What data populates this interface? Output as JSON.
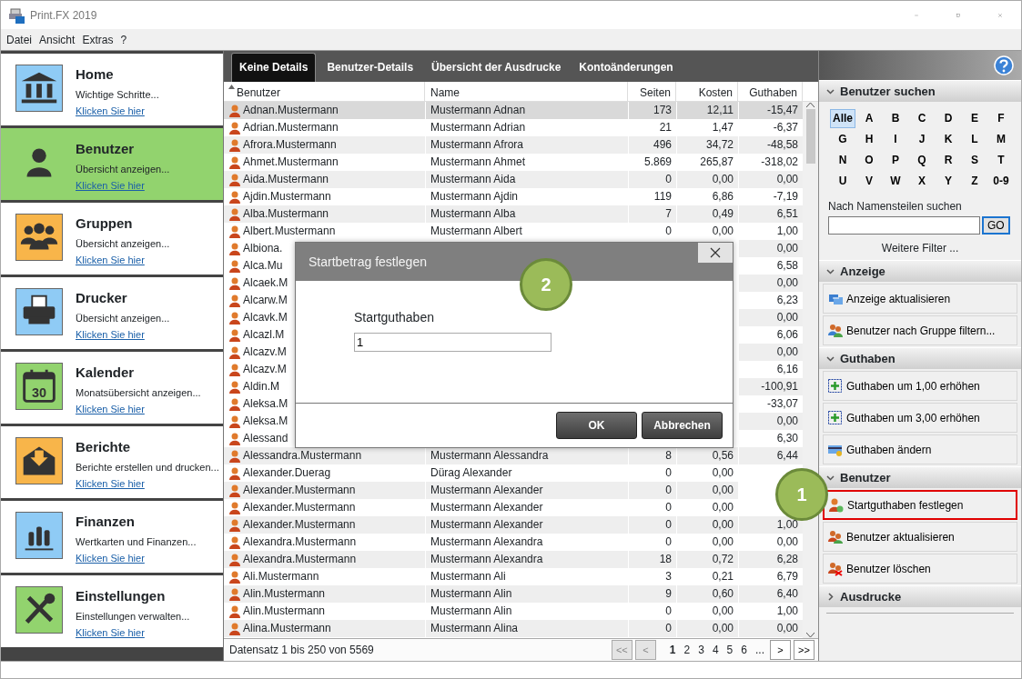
{
  "window": {
    "title": "Print.FX 2019"
  },
  "menu": [
    "Datei",
    "Ansicht",
    "Extras",
    "?"
  ],
  "nav": [
    {
      "title": "Home",
      "subtitle": "Wichtige Schritte...",
      "link": "Klicken Sie hier",
      "selected": false,
      "color": "#8fcbf5"
    },
    {
      "title": "Benutzer",
      "subtitle": "Übersicht anzeigen...",
      "link": "Klicken Sie hier",
      "selected": true,
      "color": "#92d36e"
    },
    {
      "title": "Gruppen",
      "subtitle": "Übersicht anzeigen...",
      "link": "Klicken Sie hier",
      "selected": false,
      "color": "#f8b54a"
    },
    {
      "title": "Drucker",
      "subtitle": "Übersicht anzeigen...",
      "link": "Klicken Sie hier",
      "selected": false,
      "color": "#8fcbf5"
    },
    {
      "title": "Kalender",
      "subtitle": "Monatsübersicht anzeigen...",
      "link": "Klicken Sie hier",
      "selected": false,
      "color": "#92d36e",
      "icon_text": "30"
    },
    {
      "title": "Berichte",
      "subtitle": "Berichte erstellen und drucken...",
      "link": "Klicken Sie hier",
      "selected": false,
      "color": "#f8b54a"
    },
    {
      "title": "Finanzen",
      "subtitle": "Wertkarten und Finanzen...",
      "link": "Klicken Sie hier",
      "selected": false,
      "color": "#8fcbf5"
    },
    {
      "title": "Einstellungen",
      "subtitle": "Einstellungen verwalten...",
      "link": "Klicken Sie hier",
      "selected": false,
      "color": "#92d36e"
    }
  ],
  "tabs": [
    {
      "label": "Keine Details",
      "selected": true
    },
    {
      "label": "Benutzer-Details",
      "selected": false
    },
    {
      "label": "Übersicht der Ausdrucke",
      "selected": false
    },
    {
      "label": "Kontoänderungen",
      "selected": false
    }
  ],
  "table": {
    "columns": [
      {
        "label": "Benutzer",
        "sorted": true
      },
      {
        "label": "Name",
        "sorted": false
      },
      {
        "label": "Seiten",
        "sorted": false
      },
      {
        "label": "Kosten",
        "sorted": false
      },
      {
        "label": "Guthaben",
        "sorted": false
      }
    ],
    "rows": [
      {
        "user": "Adnan.Mustermann",
        "name": "Mustermann Adnan",
        "pages": "173",
        "cost": "12,11",
        "balance": "-15,47",
        "selected": true
      },
      {
        "user": "Adrian.Mustermann",
        "name": "Mustermann Adrian",
        "pages": "21",
        "cost": "1,47",
        "balance": "-6,37",
        "selected": false
      },
      {
        "user": "Afrora.Mustermann",
        "name": "Mustermann Afrora",
        "pages": "496",
        "cost": "34,72",
        "balance": "-48,58",
        "selected": false
      },
      {
        "user": "Ahmet.Mustermann",
        "name": "Mustermann Ahmet",
        "pages": "5.869",
        "cost": "265,87",
        "balance": "-318,02",
        "selected": false
      },
      {
        "user": "Aida.Mustermann",
        "name": "Mustermann Aida",
        "pages": "0",
        "cost": "0,00",
        "balance": "0,00",
        "selected": false
      },
      {
        "user": "Ajdin.Mustermann",
        "name": "Mustermann Ajdin",
        "pages": "119",
        "cost": "6,86",
        "balance": "-7,19",
        "selected": false
      },
      {
        "user": "Alba.Mustermann",
        "name": "Mustermann Alba",
        "pages": "7",
        "cost": "0,49",
        "balance": "6,51",
        "selected": false
      },
      {
        "user": "Albert.Mustermann",
        "name": "Mustermann Albert",
        "pages": "0",
        "cost": "0,00",
        "balance": "1,00",
        "selected": false
      },
      {
        "user": "Albiona.",
        "balance": "0,00",
        "selected": false
      },
      {
        "user": "Alca.Mu",
        "balance": "6,58",
        "selected": false
      },
      {
        "user": "Alcaek.M",
        "balance": "0,00",
        "selected": false
      },
      {
        "user": "Alcarw.M",
        "balance": "6,23",
        "selected": false
      },
      {
        "user": "Alcavk.M",
        "balance": "0,00",
        "selected": false
      },
      {
        "user": "Alcazl.M",
        "balance": "6,06",
        "selected": false
      },
      {
        "user": "Alcazv.M",
        "balance": "0,00",
        "selected": false
      },
      {
        "user": "Alcazv.M",
        "balance": "6,16",
        "selected": false
      },
      {
        "user": "Aldin.M",
        "balance": "-100,91",
        "selected": false
      },
      {
        "user": "Aleksa.M",
        "balance": "-33,07",
        "selected": false
      },
      {
        "user": "Aleksa.M",
        "balance": "0,00",
        "selected": false
      },
      {
        "user": "Alessand",
        "balance": "6,30",
        "selected": false
      },
      {
        "user": "Alessandra.Mustermann",
        "name": "Mustermann Alessandra",
        "pages": "8",
        "cost": "0,56",
        "balance": "6,44",
        "selected": false
      },
      {
        "user": "Alexander.Duerag",
        "name": "Dürag Alexander",
        "pages": "0",
        "cost": "0,00",
        "selected": false
      },
      {
        "user": "Alexander.Mustermann",
        "name": "Mustermann Alexander",
        "pages": "0",
        "cost": "0,00",
        "selected": false
      },
      {
        "user": "Alexander.Mustermann",
        "name": "Mustermann Alexander",
        "pages": "0",
        "cost": "0,00",
        "selected": false
      },
      {
        "user": "Alexander.Mustermann",
        "name": "Mustermann Alexander",
        "pages": "0",
        "cost": "0,00",
        "balance": "1,00",
        "selected": false
      },
      {
        "user": "Alexandra.Mustermann",
        "name": "Mustermann Alexandra",
        "pages": "0",
        "cost": "0,00",
        "balance": "0,00",
        "selected": false
      },
      {
        "user": "Alexandra.Mustermann",
        "name": "Mustermann Alexandra",
        "pages": "18",
        "cost": "0,72",
        "balance": "6,28",
        "selected": false
      },
      {
        "user": "Ali.Mustermann",
        "name": "Mustermann Ali",
        "pages": "3",
        "cost": "0,21",
        "balance": "6,79",
        "selected": false
      },
      {
        "user": "Alin.Mustermann",
        "name": "Mustermann Alin",
        "pages": "9",
        "cost": "0,60",
        "balance": "6,40",
        "selected": false
      },
      {
        "user": "Alin.Mustermann",
        "name": "Mustermann Alin",
        "pages": "0",
        "cost": "0,00",
        "balance": "1,00",
        "selected": false
      },
      {
        "user": "Alina.Mustermann",
        "name": "Mustermann Alina",
        "pages": "0",
        "cost": "0,00",
        "balance": "0,00",
        "selected": false
      }
    ]
  },
  "pager": {
    "summary": "Datensatz 1 bis 250 von 5569",
    "first": "<<",
    "prev": "<",
    "pages": [
      {
        "label": "1",
        "selected": true
      },
      {
        "label": "2",
        "selected": false
      },
      {
        "label": "3",
        "selected": false
      },
      {
        "label": "4",
        "selected": false
      },
      {
        "label": "5",
        "selected": false
      },
      {
        "label": "6",
        "selected": false
      }
    ],
    "more": "...",
    "next": ">",
    "last": ">>"
  },
  "dialog": {
    "title": "Startbetrag festlegen",
    "field_label": "Startguthaben",
    "value": "1",
    "buttons": [
      "OK",
      "Abbrechen"
    ]
  },
  "side": {
    "sections": [
      {
        "kind": "search",
        "title": "Benutzer suchen",
        "expanded": true,
        "letters": [
          {
            "label": "Alle",
            "selected": true
          },
          {
            "label": "A",
            "selected": false
          },
          {
            "label": "B",
            "selected": false
          },
          {
            "label": "C",
            "selected": false
          },
          {
            "label": "D",
            "selected": false
          },
          {
            "label": "E",
            "selected": false
          },
          {
            "label": "F",
            "selected": false
          },
          {
            "label": "G",
            "selected": false
          },
          {
            "label": "H",
            "selected": false
          },
          {
            "label": "I",
            "selected": false
          },
          {
            "label": "J",
            "selected": false
          },
          {
            "label": "K",
            "selected": false
          },
          {
            "label": "L",
            "selected": false
          },
          {
            "label": "M",
            "selected": false
          },
          {
            "label": "N",
            "selected": false
          },
          {
            "label": "O",
            "selected": false
          },
          {
            "label": "P",
            "selected": false
          },
          {
            "label": "Q",
            "selected": false
          },
          {
            "label": "R",
            "selected": false
          },
          {
            "label": "S",
            "selected": false
          },
          {
            "label": "T",
            "selected": false
          },
          {
            "label": "U",
            "selected": false
          },
          {
            "label": "V",
            "selected": false
          },
          {
            "label": "W",
            "selected": false
          },
          {
            "label": "X",
            "selected": false
          },
          {
            "label": "Y",
            "selected": false
          },
          {
            "label": "Z",
            "selected": false
          },
          {
            "label": "0-9",
            "selected": false
          }
        ],
        "search_label": "Nach Namensteilen suchen",
        "search_button": "GO",
        "filter_link": "Weitere Filter ..."
      },
      {
        "kind": "actions",
        "title": "Anzeige",
        "expanded": true,
        "actions": [
          {
            "label": "Anzeige aktualisieren",
            "highlighted": false
          },
          {
            "label": "Benutzer nach Gruppe filtern...",
            "highlighted": false
          }
        ]
      },
      {
        "kind": "actions",
        "title": "Guthaben",
        "expanded": true,
        "actions": [
          {
            "label": "Guthaben um 1,00 erhöhen",
            "highlighted": false
          },
          {
            "label": "Guthaben um 3,00 erhöhen",
            "highlighted": false
          },
          {
            "label": "Guthaben ändern",
            "highlighted": false
          }
        ]
      },
      {
        "kind": "actions",
        "title": "Benutzer",
        "expanded": true,
        "actions": [
          {
            "label": "Startguthaben festlegen",
            "highlighted": true
          },
          {
            "label": "Benutzer aktualisieren",
            "highlighted": false
          },
          {
            "label": "Benutzer löschen",
            "highlighted": false
          }
        ]
      },
      {
        "kind": "actions",
        "title": "Ausdrucke",
        "expanded": false
      }
    ]
  },
  "callouts": [
    {
      "label": "1"
    },
    {
      "label": "2"
    }
  ]
}
